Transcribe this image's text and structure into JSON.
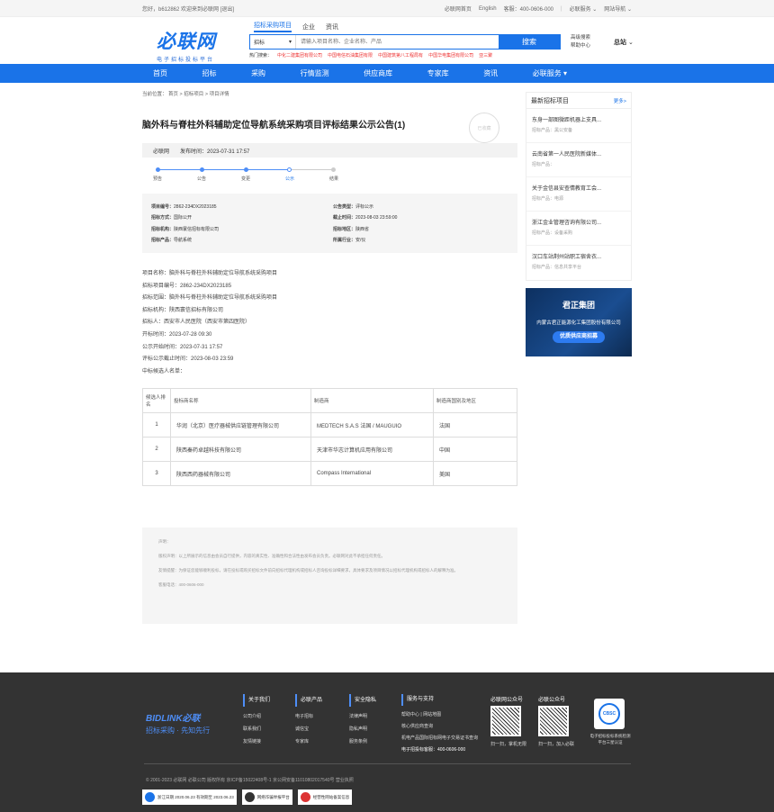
{
  "topbar": {
    "greeting": "您好，b612862  欢迎来到必联网",
    "logout": "[退出]",
    "links": [
      "必联网首页",
      "English",
      "客服：400-0606-000",
      "必联服务",
      "网站导航"
    ]
  },
  "header": {
    "logo": "必联网",
    "logo_sub": "电子招标投标平台",
    "search_tabs": [
      "招标采购项目",
      "企业",
      "资讯"
    ],
    "search_select": "招标",
    "search_placeholder": "请输入项目名称、企业名称、产品",
    "search_button": "搜索",
    "hot_label": "热门搜索：",
    "hot_items": [
      "中化二建集团有限公司",
      "中国电信石油集团有限",
      "中国建筑第八工程局有",
      "中国华电集团有限公司",
      "亚三聚"
    ],
    "right_links": [
      "高级搜索",
      "帮助中心"
    ],
    "site": "总站"
  },
  "nav": [
    "首页",
    "招标",
    "采购",
    "行情监测",
    "供应商库",
    "专家库",
    "资讯",
    "必联服务"
  ],
  "breadcrumb": "当前位置： 首页 > 招标项目 > 项目详情",
  "article": {
    "title": "脑外科与脊柱外科辅助定位导航系统采购项目评标结果公示公告(1)",
    "stamp": "已收藏",
    "source": "必联网",
    "publish": "发布时间：2023-07-31 17:57",
    "steps": [
      "预告",
      "公告",
      "变更",
      "公示",
      "结果"
    ],
    "info": [
      {
        "k": "项目编号：",
        "v": "2862-234DX2023185"
      },
      {
        "k": "公告类型：",
        "v": "评标公示"
      },
      {
        "k": "招标方式：",
        "v": "国际公开"
      },
      {
        "k": "截止时间：",
        "v": "2023-08-03 23:59:00"
      },
      {
        "k": "招标机构：",
        "v": "陕西寰信招标有限公司"
      },
      {
        "k": "招标地区：",
        "v": "陕西省"
      },
      {
        "k": "招标产品：",
        "v": "导航系统"
      },
      {
        "k": "所属行业：",
        "v": "安/仪"
      }
    ],
    "content": [
      "项目名称：脑外科与脊柱外科辅助定位导航系统采购项目",
      "招标项目编号：2862-234DX2023185",
      "招标范围：脑外科与脊柱外科辅助定位导航系统采购项目",
      "招标机构：陕西寰信招标有限公司",
      "招标人：西安市人民医院（西安市第四医院）",
      "开标时间：2023-07-28 09:30",
      "公示开始时间：2023-07-31 17:57",
      "评标公示截止时间：2023-08-03 23:59",
      "中标候选人名单："
    ],
    "table_headers": [
      "候选人排名",
      "投标商名称",
      "制造商",
      "制造商国别及地区"
    ],
    "table_rows": [
      [
        "1",
        "华润（北京）医疗器械供应链管理有限公司",
        "MEDTECH S.A.S 法国 / MAUGUIO",
        "法国"
      ],
      [
        "2",
        "陕西秦药卓越科技有限公司",
        "天津市华志计算机应用有限公司",
        "中国"
      ],
      [
        "3",
        "陕西西药器械有限公司",
        "Compass International",
        "美国"
      ]
    ],
    "notice": [
      "声明：",
      "版权声明：以上所展示的信息由会员自行提供，内容的真实性、准确性和合法性由发布会员负责。必联网对此不承担任何责任。",
      "友情提醒：为保证您能够顺利投标，请在投标或购买招标文件前向招标代理机构或招标人咨询投标详细要求，具体要求及项目情况以招标代理机构或招标人的解释为准。",
      "客服电话：400-0606-000"
    ]
  },
  "side": {
    "title": "最新招标项目",
    "more": "更多>",
    "items": [
      {
        "t": "东身一部图微距机器上支具...",
        "s": "招标产品：黑公安备"
      },
      {
        "t": "云南省第一人民医院新媒体...",
        "s": "招标产品："
      },
      {
        "t": "关于金信县安查情教育工会...",
        "s": "招标产品：电源"
      },
      {
        "t": "浙江金业管理咨询有限公司...",
        "s": "招标产品：设备采购"
      },
      {
        "t": "汉口车站荆州站职工宿舍衣...",
        "s": "招标产品：信息共享平台"
      }
    ],
    "ad_title": "君正集团",
    "ad_sub": "内蒙古君正能源化工集团股份有限公司",
    "ad_button": "优质供应商招募"
  },
  "footer": {
    "logo": "BIDLINK必联",
    "slogan": "招标采购 · 先知先行",
    "cols": [
      {
        "h": "关于我们",
        "items": [
          "公司介绍",
          "联系我们",
          "友情链接"
        ]
      },
      {
        "h": "必联产品",
        "items": [
          "电子招标",
          "诚信宝",
          "专家库"
        ]
      },
      {
        "h": "安全隐私",
        "items": [
          "法律声明",
          "隐私声明",
          "服务条例"
        ]
      },
      {
        "h": "服务与支持",
        "items": [
          "帮助中心  |  网站地图",
          "核心供应商查询",
          "机电产品国际招标网电子交易证书查询",
          "电子招投标客服：400-0606-000"
        ]
      }
    ],
    "qr1_title": "必联网公众号",
    "qr1_label": "扫一扫，掌机无限",
    "qr2_title": "必联公众号",
    "qr2_label": "扫一扫，加入必联",
    "cert_text": "CBSC",
    "cert_label": "电子招标投标系统检测平台三星认证",
    "copyright": "© 2001-2023 必联网 必联公司   版权所有 京ICP备15022408号-1 京公网安备11010802017540号        营业执照",
    "badges": [
      "浙江日期 2020.06.23 有效期至 2023.06.23",
      "网络诈骗举报平台",
      "经营性网站备案信息"
    ]
  }
}
